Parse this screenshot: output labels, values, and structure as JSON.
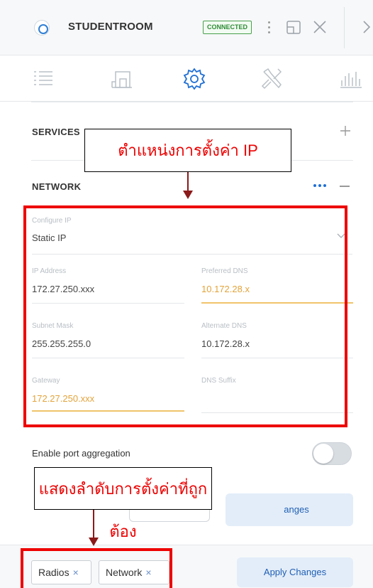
{
  "header": {
    "device_name": "STUDENTROOM",
    "status": "CONNECTED",
    "colors": {
      "status": "#2e8b35",
      "accent": "#1f6fd4"
    }
  },
  "tabs": [
    {
      "icon": "list-icon"
    },
    {
      "icon": "device-icon"
    },
    {
      "icon": "gear-icon",
      "active": true
    },
    {
      "icon": "tools-icon"
    },
    {
      "icon": "stats-icon"
    }
  ],
  "sections": {
    "services": {
      "title": "SERVICES"
    },
    "network": {
      "title": "NETWORK"
    }
  },
  "network_form": {
    "configure_ip": {
      "label": "Configure IP",
      "value": "Static IP"
    },
    "ip_address": {
      "label": "IP Address",
      "value": "172.27.250.xxx"
    },
    "preferred_dns": {
      "label": "Preferred DNS",
      "value": "10.172.28.x"
    },
    "subnet_mask": {
      "label": "Subnet Mask",
      "value": "255.255.255.0"
    },
    "alternate_dns": {
      "label": "Alternate DNS",
      "value": "10.172.28.x"
    },
    "gateway": {
      "label": "Gateway",
      "value": "172.27.250.xxx"
    },
    "dns_suffix": {
      "label": "DNS Suffix",
      "value": ""
    }
  },
  "port_aggregation": {
    "label": "Enable port aggregation",
    "enabled": false
  },
  "mid_buttons": {
    "apply_partial": "anges"
  },
  "annotations": {
    "ip_position": "ตำแหน่งการตั้งค่า IP",
    "order_note": "แสดงลำดับการตั้งค่าที่ถูกต้อง"
  },
  "bottom": {
    "chips": [
      {
        "label": "Radios"
      },
      {
        "label": "Network"
      }
    ],
    "chip_close": "×",
    "apply_label": "Apply Changes"
  }
}
